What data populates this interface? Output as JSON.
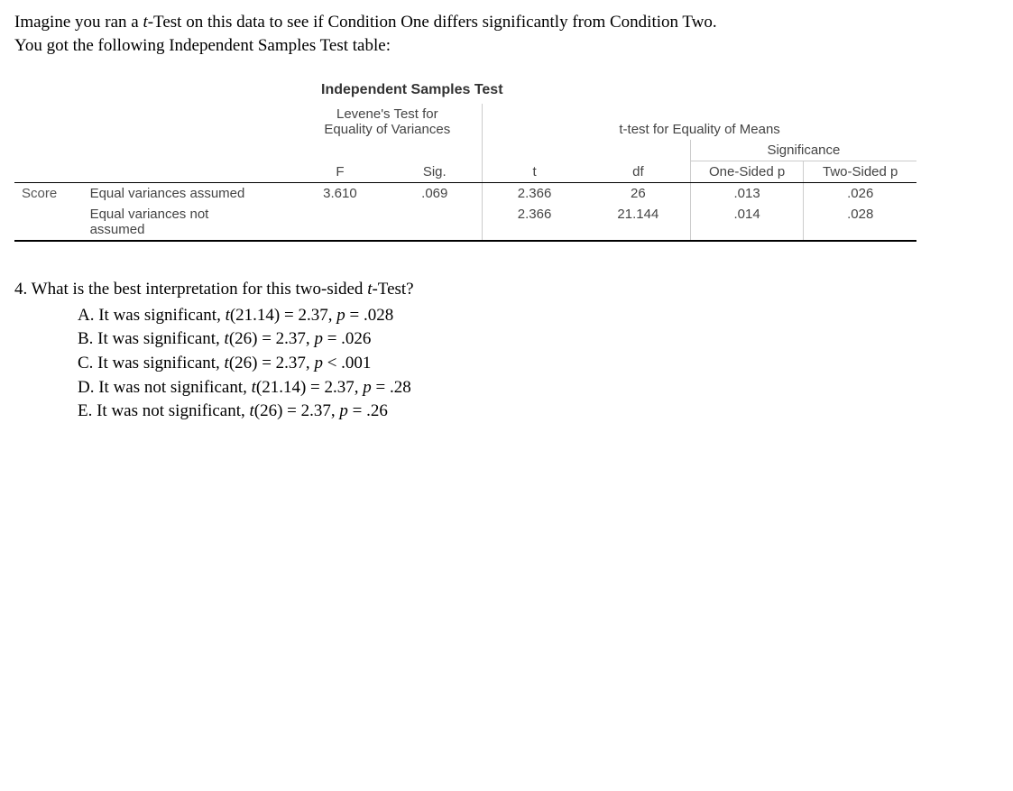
{
  "intro": {
    "line1_a": "Imagine you ran a ",
    "line1_b": "t",
    "line1_c": "-Test on this data to see if Condition One differs significantly from Condition Two.",
    "line2": "You got the following Independent Samples Test table:"
  },
  "table": {
    "title": "Independent Samples Test",
    "levene_label_1": "Levene's Test for",
    "levene_label_2": "Equality of Variances",
    "ttest_label": "t-test for Equality of Means",
    "sig_group": "Significance",
    "headers": {
      "F": "F",
      "Sig": "Sig.",
      "t": "t",
      "df": "df",
      "one": "One-Sided p",
      "two": "Two-Sided p"
    },
    "var_label": "Score",
    "rows": [
      {
        "label": "Equal variances assumed",
        "F": "3.610",
        "Sig": ".069",
        "t": "2.366",
        "df": "26",
        "one": ".013",
        "two": ".026"
      },
      {
        "label_a": "Equal variances not",
        "label_b": "assumed",
        "F": "",
        "Sig": "",
        "t": "2.366",
        "df": "21.144",
        "one": ".014",
        "two": ".028"
      }
    ]
  },
  "question": {
    "num": "4.",
    "stem_a": " What is the best interpretation for this two-sided ",
    "stem_b": "t",
    "stem_c": "-Test?",
    "opts": {
      "A": {
        "pre": "A. It was significant, ",
        "t": "t",
        "post": "(21.14) = 2.37, ",
        "p": "p",
        "end": " = .028"
      },
      "B": {
        "pre": "B. It was significant, ",
        "t": "t",
        "post": "(26) = 2.37, ",
        "p": "p",
        "end": " = .026"
      },
      "C": {
        "pre": "C. It was significant, ",
        "t": "t",
        "post": "(26) = 2.37, ",
        "p": "p",
        "end": " < .001"
      },
      "D": {
        "pre": "D. It was not significant, ",
        "t": "t",
        "post": "(21.14) = 2.37, ",
        "p": "p",
        "end": " = .28"
      },
      "E": {
        "pre": "E. It was not significant, ",
        "t": "t",
        "post": "(26) = 2.37, ",
        "p": "p",
        "end": " = .26"
      }
    }
  }
}
